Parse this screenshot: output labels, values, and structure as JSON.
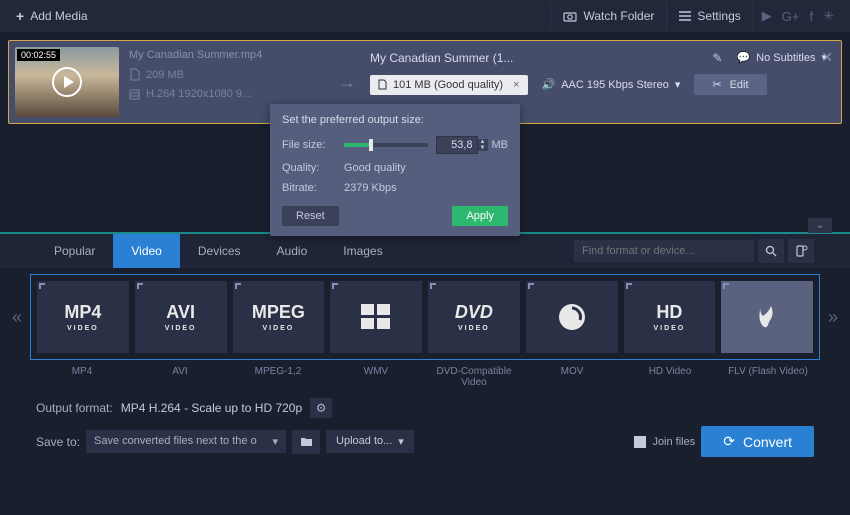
{
  "toolbar": {
    "add_media": "Add Media",
    "watch_folder": "Watch Folder",
    "settings": "Settings"
  },
  "file": {
    "thumb_time": "00:02:55",
    "name": "My Canadian Summer.mp4",
    "size": "209 MB",
    "codec": "H.264 1920x1080 9...",
    "output_name": "My Canadian Summer (1...",
    "subtitles": "No Subtitles",
    "output_size": "101 MB (Good quality)",
    "audio": "AAC 195 Kbps Stereo",
    "edit": "Edit"
  },
  "popup": {
    "title": "Set the preferred output size:",
    "filesize_label": "File size:",
    "filesize_value": "53,8",
    "filesize_unit": "MB",
    "quality_label": "Quality:",
    "quality_value": "Good quality",
    "bitrate_label": "Bitrate:",
    "bitrate_value": "2379 Kbps",
    "reset": "Reset",
    "apply": "Apply"
  },
  "tabs": [
    "Popular",
    "Video",
    "Devices",
    "Audio",
    "Images"
  ],
  "search_placeholder": "Find format or device...",
  "formats": [
    {
      "big": "MP4",
      "sub": "VIDEO",
      "label": "MP4"
    },
    {
      "big": "AVI",
      "sub": "VIDEO",
      "label": "AVI"
    },
    {
      "big": "MPEG",
      "sub": "VIDEO",
      "label": "MPEG-1,2"
    },
    {
      "big": "WMV",
      "sub": "",
      "label": "WMV"
    },
    {
      "big": "DVD",
      "sub": "VIDEO",
      "label": "DVD-Compatible Video"
    },
    {
      "big": "MOV",
      "sub": "",
      "label": "MOV"
    },
    {
      "big": "HD",
      "sub": "VIDEO",
      "label": "HD Video"
    },
    {
      "big": "FLV",
      "sub": "",
      "label": "FLV (Flash Video)"
    }
  ],
  "bottom": {
    "output_format_label": "Output format:",
    "output_format_value": "MP4 H.264 - Scale up to HD 720p",
    "save_to_label": "Save to:",
    "save_to_value": "Save converted files next to the o",
    "upload": "Upload to...",
    "join_files": "Join files",
    "convert": "Convert"
  }
}
